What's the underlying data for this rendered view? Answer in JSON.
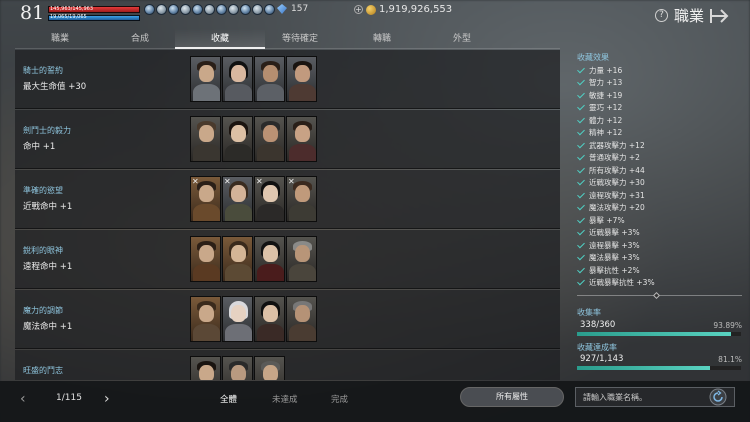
{
  "status": {
    "level": "81",
    "hp_text": "145,963/145,963",
    "mp_text": "19,065/19,065",
    "crystals": "157",
    "gold": "1,919,926,553"
  },
  "header": {
    "title": "職業",
    "help": "?"
  },
  "tabs": [
    {
      "label": "職業"
    },
    {
      "label": "合成"
    },
    {
      "label": "收藏"
    },
    {
      "label": "等待確定"
    },
    {
      "label": "轉職"
    },
    {
      "label": "外型"
    }
  ],
  "active_tab": "收藏",
  "collections": [
    {
      "name": "騎士的誓約",
      "effect": "最大生命值 +30",
      "cards": 4
    },
    {
      "name": "劍鬥士的毅力",
      "effect": "命中 +1",
      "cards": 4
    },
    {
      "name": "準確的慾望",
      "effect": "近戰命中 +1",
      "cards": 4
    },
    {
      "name": "銳利的眼神",
      "effect": "遠程命中 +1",
      "cards": 4
    },
    {
      "name": "魔力的調節",
      "effect": "魔法命中 +1",
      "cards": 4
    },
    {
      "name": "旺盛的鬥志",
      "effect": "",
      "cards": 3
    }
  ],
  "panel": {
    "title": "收藏效果",
    "stats": [
      "力量 +16",
      "智力 +13",
      "敏捷 +19",
      "靈巧 +12",
      "體力 +12",
      "精神 +12",
      "武器攻擊力 +12",
      "普通攻擊力 +2",
      "所有攻擊力 +44",
      "近戰攻擊力 +30",
      "遠程攻擊力 +31",
      "魔法攻擊力 +20",
      "暴擊 +7%",
      "近戰暴擊 +3%",
      "遠程暴擊 +3%",
      "魔法暴擊 +3%",
      "暴擊抗性 +2%",
      "近戰暴擊抗性 +3%"
    ],
    "collect_rate": {
      "label": "收集率",
      "value": "338/360",
      "percent": "93.89%",
      "fraction": 0.9389
    },
    "complete_rate": {
      "label": "收藏達成率",
      "value": "927/1,143",
      "percent": "81.1%",
      "fraction": 0.811
    }
  },
  "bottom": {
    "prev": "‹",
    "page": "1/115",
    "next": "›",
    "filters": [
      "全體",
      "未達成",
      "完成"
    ],
    "active_filter": "全體",
    "attr_button": "所有屬性",
    "search_placeholder": "請輸入職業名稱。"
  }
}
